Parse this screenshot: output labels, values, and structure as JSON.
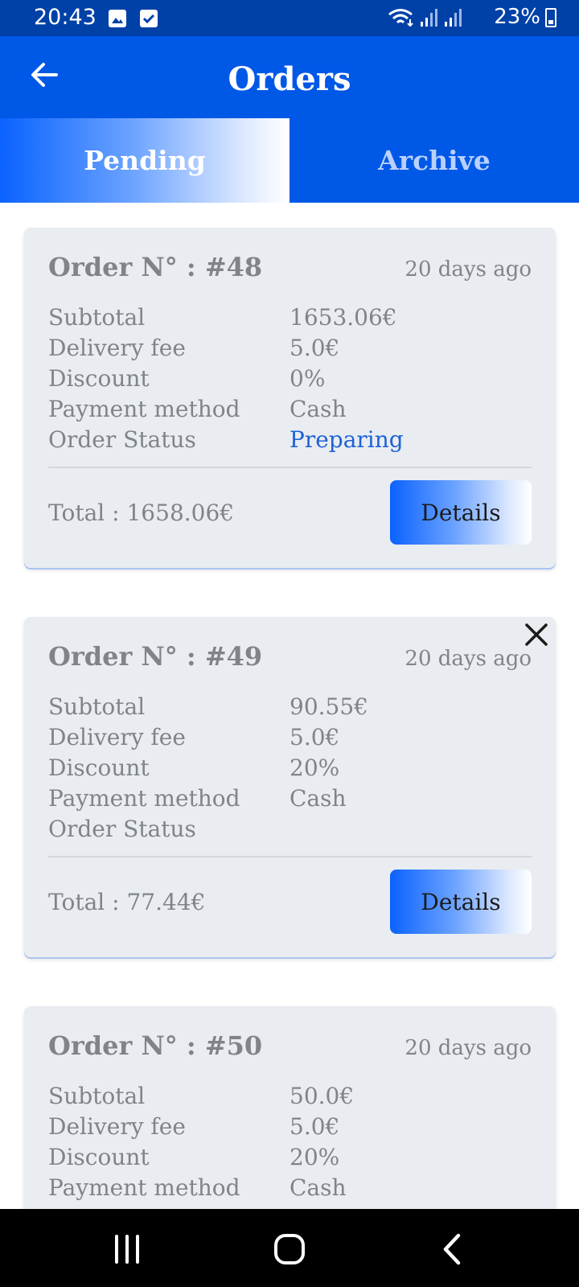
{
  "status_bar": {
    "time": "20:43",
    "battery": "23%",
    "icons": [
      "image-icon",
      "checkbox-icon",
      "wifi-icon",
      "signal-icon",
      "signal-icon",
      "battery-icon"
    ]
  },
  "header": {
    "title": "Orders",
    "back_icon": "back-arrow-icon"
  },
  "tabs": [
    {
      "label": "Pending",
      "active": true
    },
    {
      "label": "Archive",
      "active": false
    }
  ],
  "orders": [
    {
      "number": "Order N° : #48",
      "time": "20 days ago",
      "rows": [
        {
          "label": "Subtotal",
          "value": "1653.06€"
        },
        {
          "label": "Delivery fee",
          "value": "5.0€"
        },
        {
          "label": "Discount",
          "value": "0%"
        },
        {
          "label": "Payment method",
          "value": "Cash"
        },
        {
          "label": "Order Status",
          "value": "Preparing"
        }
      ],
      "total": "Total : 1658.06€",
      "details_label": "Details"
    },
    {
      "number": "Order N° : #49",
      "time": "20 days ago",
      "rows": [
        {
          "label": "Subtotal",
          "value": "90.55€"
        },
        {
          "label": "Delivery fee",
          "value": "5.0€"
        },
        {
          "label": "Discount",
          "value": "20%"
        },
        {
          "label": "Payment method",
          "value": "Cash"
        },
        {
          "label": "Order Status",
          "value": ""
        }
      ],
      "total": "Total : 77.44€",
      "details_label": "Details",
      "close_icon": "close-icon"
    },
    {
      "number": "Order N° : #50",
      "time": "20 days ago",
      "rows": [
        {
          "label": "Subtotal",
          "value": "50.0€"
        },
        {
          "label": "Delivery fee",
          "value": "5.0€"
        },
        {
          "label": "Discount",
          "value": "20%"
        },
        {
          "label": "Payment method",
          "value": "Cash"
        }
      ]
    }
  ],
  "colors": {
    "primary": "#0058e6",
    "status_bar": "#0041a8",
    "card_bg": "#e9edf1",
    "status_preparing": "#1f62d6"
  },
  "nav_bar": {
    "icons": [
      "recent-apps-icon",
      "home-icon",
      "nav-back-icon"
    ]
  }
}
